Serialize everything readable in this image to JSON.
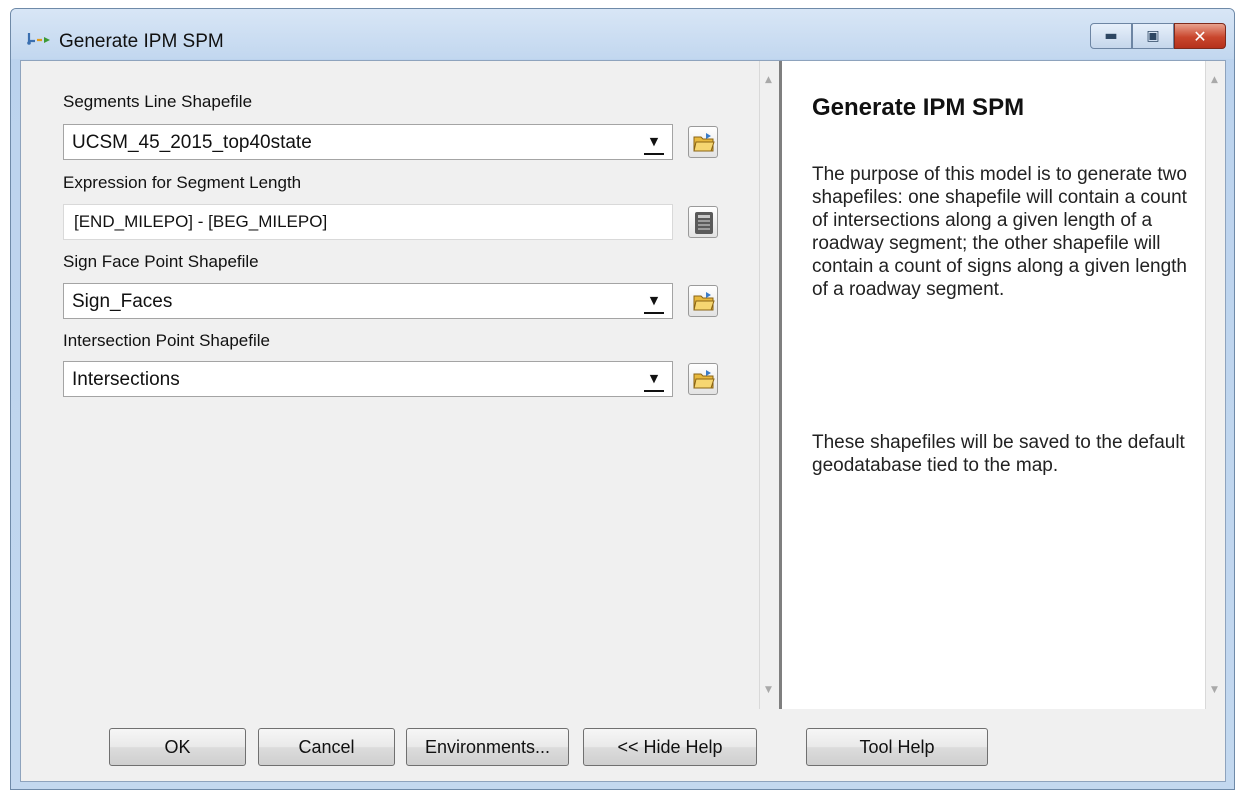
{
  "window": {
    "title": "Generate IPM SPM",
    "controls": {
      "minimize_icon": "minimize-icon",
      "maximize_icon": "maximize-icon",
      "close_icon": "close-icon"
    }
  },
  "params": [
    {
      "label": "Segments Line Shapefile",
      "value": "UCSM_45_2015_top40state",
      "type": "combo",
      "button_icon": "open-folder-icon"
    },
    {
      "label": "Expression for Segment Length",
      "value": "[END_MILEPO] - [BEG_MILEPO]",
      "type": "text",
      "button_icon": "calculator-icon"
    },
    {
      "label": "Sign Face Point Shapefile",
      "value": "Sign_Faces",
      "type": "combo",
      "button_icon": "open-folder-icon"
    },
    {
      "label": "Intersection Point Shapefile",
      "value": "Intersections",
      "type": "combo",
      "button_icon": "open-folder-icon"
    }
  ],
  "help": {
    "title": "Generate IPM SPM",
    "paragraphs": [
      "The purpose of this model is to generate two shapefiles: one shapefile will contain a count of intersections along a given length of a roadway segment; the other shapefile will contain a count of signs along a given length of a roadway segment.",
      "These shapefiles will be saved to the default geodatabase tied to the map."
    ]
  },
  "buttons": {
    "ok": "OK",
    "cancel": "Cancel",
    "environments": "Environments...",
    "hide_help": "<< Hide Help",
    "tool_help": "Tool Help"
  }
}
